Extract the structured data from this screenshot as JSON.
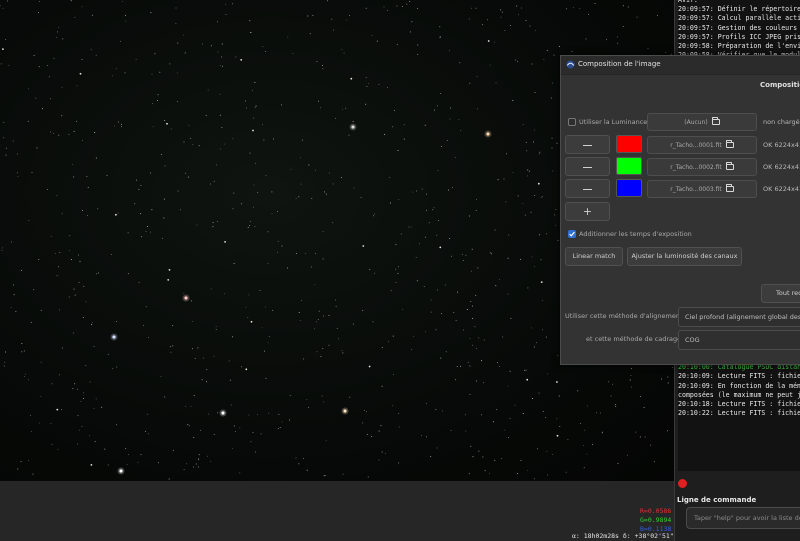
{
  "image_panel": {
    "pixel_readout": {
      "r": "R=0.0586",
      "g": "G=0.9894",
      "b": "B=0.1138"
    },
    "coordinates": "α: 18h02m28s δ: +38°02'51\""
  },
  "log": {
    "lines_top": [
      "Avif.",
      "20:09:57: Définir le répertoire",
      "20:09:57: Calcul parallèle acti",
      "20:09:57: Gestion des couleurs",
      "20:09:57: Profils ICC JPEG pris",
      "20:09:58: Préparation de l'envi",
      "20:09:58: Vérifier que le modul"
    ],
    "lines_bottom": [
      "s.cloud.ovh.net (3 miroirs fonc",
      "20:10:00: Catalogue PSUC distan",
      "20:10:09: Lecture FITS : fichie",
      "20:10:09: En fonction de la mém",
      "composées (le maximum ne peut j",
      "20:10:18: Lecture FITS : fichie",
      "20:10:22: Lecture FITS : fichie"
    ],
    "command_label": "Ligne de commande",
    "command_placeholder": "Taper \"help\" pour avoir la liste des co"
  },
  "dialog": {
    "title": "Composition de l'image",
    "heading": "Composition",
    "luminance": {
      "label": "Utiliser la Luminance",
      "file": "(Aucun)",
      "status": "non chargée"
    },
    "layers": [
      {
        "color": "#ff0000",
        "file": "r_Tacho...0001.fit",
        "status": "OK 6224x416"
      },
      {
        "color": "#00ff00",
        "file": "r_Tacho...0002.fit",
        "status": "OK 6224x416"
      },
      {
        "color": "#0000ff",
        "file": "r_Tacho...0003.fit",
        "status": "OK 6224x416"
      }
    ],
    "add_button": "+",
    "sum_exposure_label": "Additionner les temps d'exposition",
    "linear_match": "Linear match",
    "adjust_brightness": "Ajuster la luminosité des canaux",
    "tout_button": "Tout rect",
    "align_method_label": "Utiliser cette méthode d'alignement :",
    "align_method_value": "Ciel profond (alignement global des éto",
    "framing_method_label": "et cette méthode de cadrage :",
    "framing_method_value": "COG"
  },
  "colors": {
    "red_readout": "#e03030",
    "green_readout": "#30d030",
    "blue_readout": "#3060e0",
    "checkbox_checked": "#2f6fd6"
  }
}
